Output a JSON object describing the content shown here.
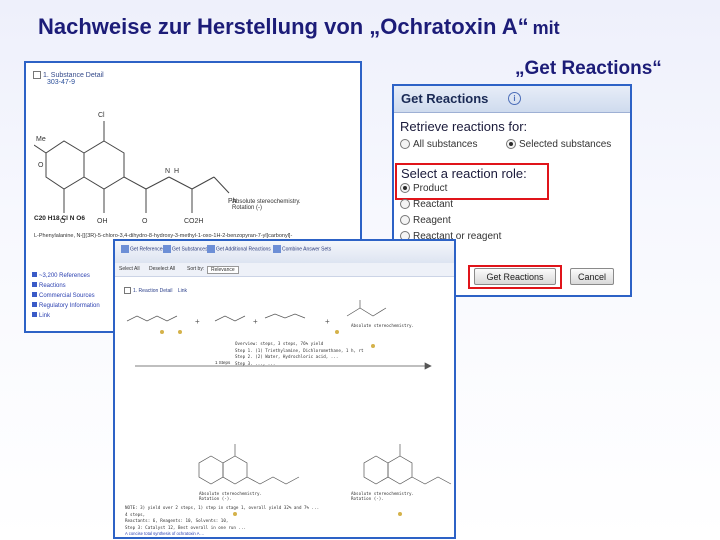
{
  "slide": {
    "title": "Nachweise zur Herstellung von „Ochratoxin A“",
    "title_suffix": "mit",
    "subtitle": "„Get Reactions“"
  },
  "substance_panel": {
    "heading": "1. Substance Detail",
    "registry_number": "303-47-9",
    "stereo_label": "Absolute stereochemistry.",
    "rotation_label": "Rotation (-)",
    "formula": "C20 H18 Cl N O6",
    "name": "L-Phenylalanine, N-[[(3R)-5-chloro-3,4-dihydro-8-hydroxy-3-methyl-1-oxo-1H-2-benzopyran-7-yl]carbonyl]-",
    "atom_labels": {
      "cl": "Cl",
      "me": "Me",
      "o": "O",
      "oh": "OH",
      "h": "H",
      "n": "N",
      "co2h": "CO2H",
      "ph": "Ph"
    },
    "links": [
      "~3,200 References",
      "Reactions",
      "Commercial Sources",
      "Regulatory Information",
      "Link"
    ]
  },
  "dialog": {
    "title": "Get Reactions",
    "info_icon": "i",
    "retrieve_label": "Retrieve reactions for:",
    "retrieve_options": [
      {
        "label": "All substances",
        "selected": false
      },
      {
        "label": "Selected substances",
        "selected": true
      }
    ],
    "role_label": "Select a reaction role:",
    "roles": [
      {
        "label": "Product",
        "selected": true
      },
      {
        "label": "Reactant",
        "selected": false
      },
      {
        "label": "Reagent",
        "selected": false
      },
      {
        "label": "Reactant or reagent",
        "selected": false
      }
    ],
    "get_button": "Get Reactions",
    "cancel_button": "Cancel"
  },
  "reaction_panel": {
    "toolbar": [
      "Get References",
      "Get Substances",
      "Get Additional Reactions",
      "Combine Answer Sets"
    ],
    "filter": {
      "select_all": "Select All",
      "deselect_all": "Deselect All",
      "sort_label": "Sort by:",
      "sort_value": "Relevance"
    },
    "detail_heading": "1. Reaction Detail",
    "detail_link": "Link",
    "plus": "+",
    "stereo_right": "Absolute stereochemistry.",
    "step_label": "1 Steps",
    "conditions": [
      "Overview: steps, 3 steps, 76% yield",
      "Step 1. (1) Triethylamine, Dichloromethane, 1 h, rt",
      "Step 2. (2) Water, Hydrochloric acid, ...",
      "Step 3. ..., ..."
    ],
    "stereo_bottom_left": "Absolute stereochemistry.",
    "rotation_bottom_left": "Rotation (-).",
    "stereo_bottom_right": "Absolute stereochemistry.",
    "rotation_bottom_right": "Rotation (-).",
    "note_lines": [
      "NOTE: 3) yield over 2 steps, 1) step in stage 1, overall yield 32% and 7% ...",
      "4 steps,",
      "Reactants: 6, Reagents: 10, Solvents: 10,",
      "Step 3: Catalyst 12, Best overall in one run ..."
    ],
    "reference_lines": [
      "A concise total synthesis of ochratoxin A ...",
      "By Gabriele, Bartolo; et al",
      "From Synthesis, (12), 2026-2030; 2004"
    ]
  }
}
